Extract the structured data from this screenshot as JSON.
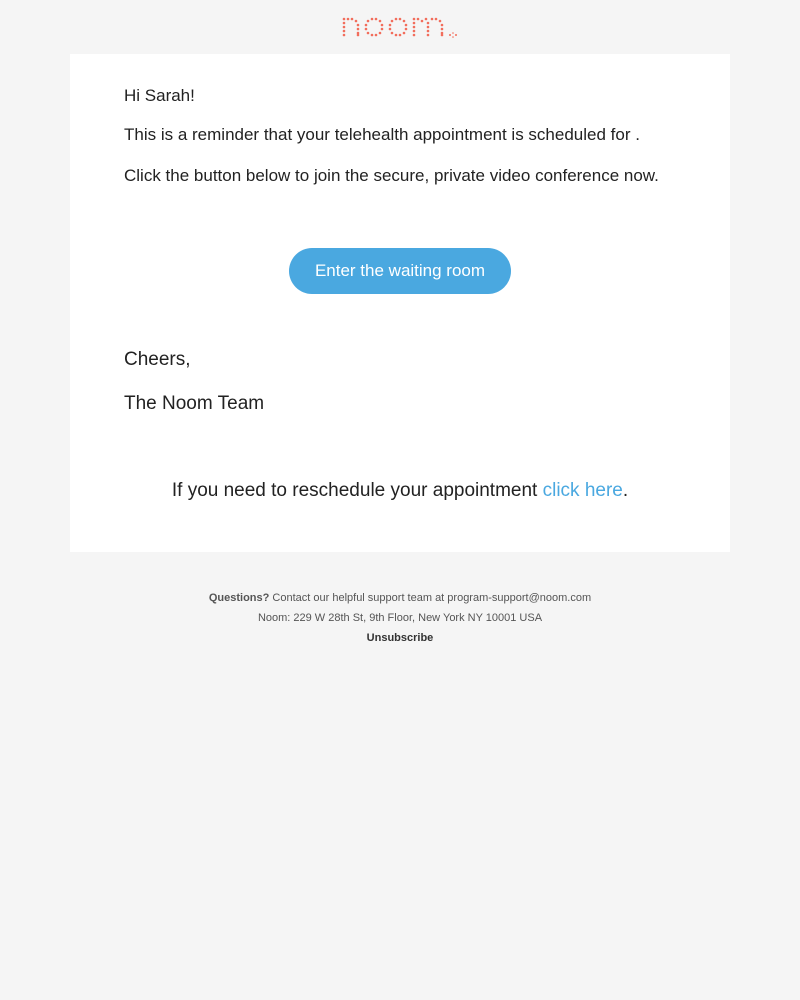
{
  "logo": {
    "alt": "noom",
    "color": "#f26d5b"
  },
  "content": {
    "greeting": "Hi Sarah!",
    "reminder": "This is a reminder that your telehealth appointment is scheduled for .",
    "instruction": "Click the button below to join the secure, private video conference now.",
    "cta_label": "Enter the waiting room",
    "signoff": "Cheers,",
    "team": "The Noom Team",
    "reschedule_prefix": "If you need to reschedule your appointment ",
    "reschedule_link": "click here",
    "reschedule_suffix": "."
  },
  "footer": {
    "questions_label": "Questions?",
    "support_text": " Contact our helpful support team at program-support@noom.com",
    "address": "Noom: 229 W 28th St, 9th Floor, New York NY 10001 USA",
    "unsubscribe": "Unsubscribe"
  }
}
